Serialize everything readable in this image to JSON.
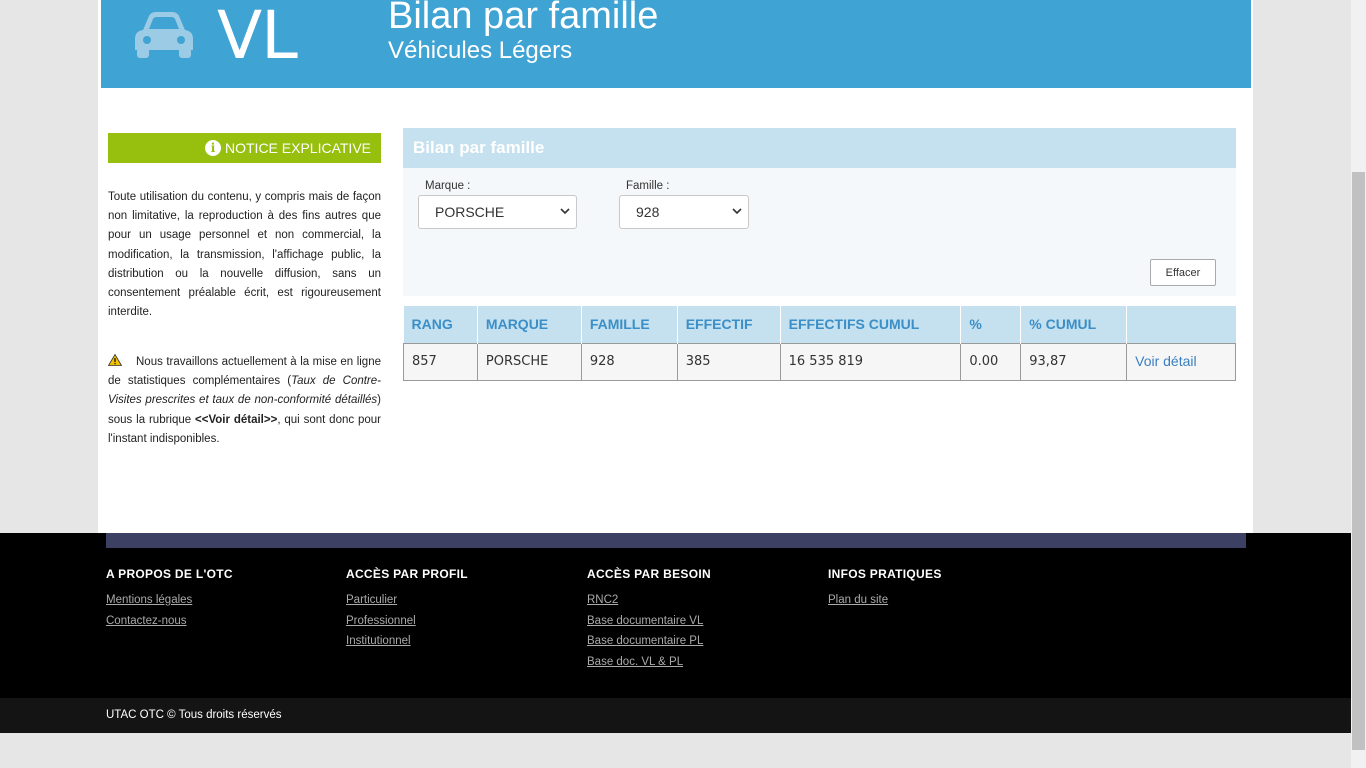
{
  "header": {
    "code": "VL",
    "title": "Bilan par famille",
    "subtitle": "Véhicules Légers",
    "icon": "car-icon"
  },
  "notice": {
    "button_label": "NOTICE EXPLICATIVE",
    "text": "Toute utilisation du contenu, y compris mais de façon non limitative, la reproduction à des fins autres que pour un usage personnel et non commercial, la modification, la transmission, l'affichage public, la distribution ou la nouvelle diffusion, sans un consentement préalable écrit, est rigoureusement interdite.",
    "warning_part1": "Nous travaillons actuellement à la mise en ligne de statistiques complémentaires (",
    "warning_italic": "Taux de Contre-Visites prescrites et taux de non-conformité détaillés",
    "warning_part2": ") sous la rubrique ",
    "warning_bold": "<<Voir détail>>",
    "warning_part3": ", qui sont donc pour l'instant indisponibles."
  },
  "filters": {
    "panel_title": "Bilan par famille",
    "marque_label": "Marque :",
    "marque_value": "PORSCHE",
    "famille_label": "Famille :",
    "famille_value": "928",
    "clear_label": "Effacer"
  },
  "table": {
    "headers": [
      "RANG",
      "MARQUE",
      "FAMILLE",
      "EFFECTIF",
      "EFFECTIFS CUMUL",
      "%",
      "% CUMUL",
      ""
    ],
    "rows": [
      {
        "rang": "857",
        "marque": "PORSCHE",
        "famille": "928",
        "effectif": "385",
        "cumul": "16 535 819",
        "pct": "0.00",
        "pct_cumul": "93,87",
        "link": "Voir détail"
      }
    ]
  },
  "footer": {
    "col1": {
      "title": "A PROPOS DE L'OTC",
      "links": [
        "Mentions légales",
        "Contactez-nous"
      ]
    },
    "col2": {
      "title": "ACCÈS PAR PROFIL",
      "links": [
        "Particulier",
        "Professionnel",
        "Institutionnel"
      ]
    },
    "col3": {
      "title": "ACCÈS PAR BESOIN",
      "links": [
        "RNC2",
        "Base documentaire VL",
        "Base documentaire PL",
        "Base doc. VL & PL"
      ]
    },
    "col4": {
      "title": "INFOS PRATIQUES",
      "links": [
        "Plan du site"
      ]
    },
    "copyright": "UTAC OTC © Tous droits réservés"
  },
  "colors": {
    "banner": "#3fa3d4",
    "notice_green": "#97bf0d",
    "panel_head": "#c5e0ee",
    "header_text": "#3a8fc8",
    "footer_band": "#3c4063"
  }
}
